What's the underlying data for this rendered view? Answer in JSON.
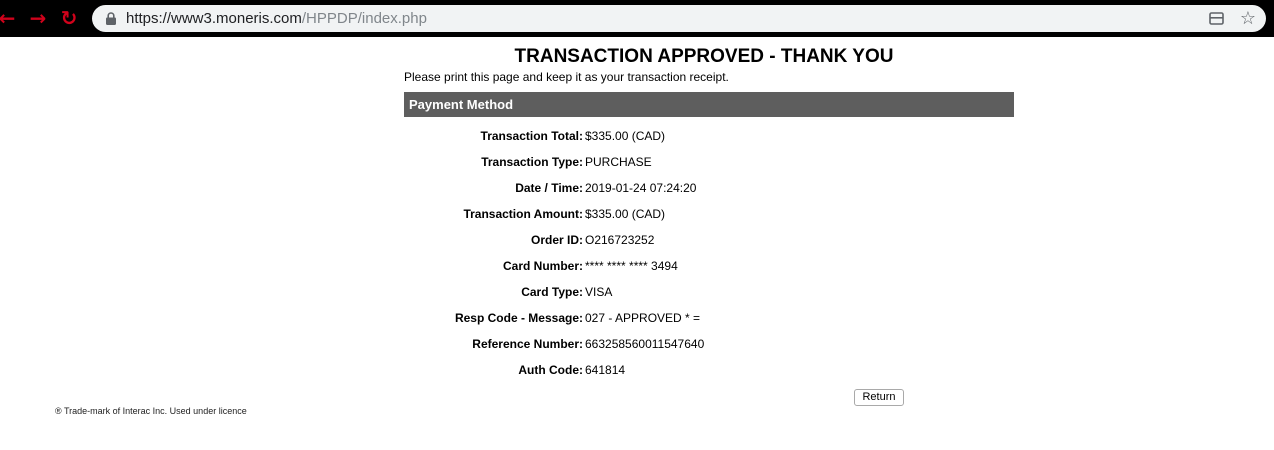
{
  "browser": {
    "url_host": "https://www3.moneris.com",
    "url_path": "/HPPDP/index.php"
  },
  "page": {
    "title": "TRANSACTION APPROVED - THANK YOU",
    "instructions": "Please print this page and keep it as your transaction receipt.",
    "section_header": "Payment Method",
    "rows": [
      {
        "label": "Transaction Total:",
        "value": "$335.00 (CAD)"
      },
      {
        "label": "Transaction Type:",
        "value": "PURCHASE"
      },
      {
        "label": "Date / Time:",
        "value": "2019-01-24 07:24:20"
      },
      {
        "label": "Transaction Amount:",
        "value": "$335.00 (CAD)"
      },
      {
        "label": "Order ID:",
        "value": "O216723252"
      },
      {
        "label": "Card Number:",
        "value": "**** **** **** 3494"
      },
      {
        "label": "Card Type:",
        "value": "VISA"
      },
      {
        "label": "Resp Code - Message:",
        "value": "027 - APPROVED * ="
      },
      {
        "label": "Reference Number:",
        "value": "663258560011547640"
      },
      {
        "label": "Auth Code:",
        "value": "641814"
      }
    ],
    "return_label": "Return",
    "footer_note": "® Trade-mark of Interac Inc. Used under licence"
  },
  "colors": {
    "nav_red": "#d0021b",
    "section_header_bg": "#5e5e5e"
  },
  "icons": {
    "back": "arrow-left-icon",
    "forward": "arrow-right-icon",
    "reload": "reload-icon",
    "lock": "lock-icon",
    "tab": "tab-icon",
    "bookmark": "star-icon"
  }
}
